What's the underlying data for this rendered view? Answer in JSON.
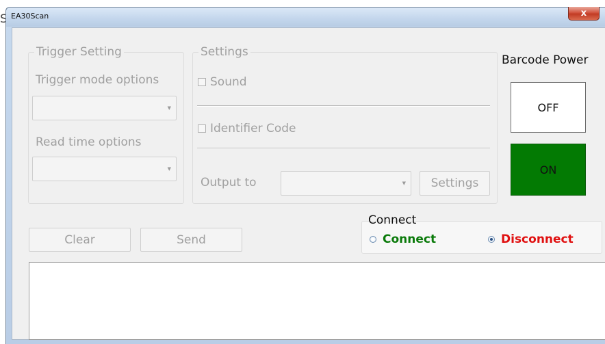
{
  "background_window": {
    "partial_char": "S"
  },
  "window": {
    "title": "EA30Scan",
    "close_glyph": "x"
  },
  "trigger_group": {
    "legend": "Trigger Setting",
    "mode_label": "Trigger mode options",
    "mode_value": "",
    "read_time_label": "Read time options",
    "read_time_value": ""
  },
  "settings_group": {
    "legend": "Settings",
    "sound_label": "Sound",
    "sound_checked": false,
    "identifier_label": "Identifier Code",
    "identifier_checked": false,
    "output_label": "Output to",
    "output_value": "",
    "settings_button": "Settings"
  },
  "barcode_power": {
    "title": "Barcode Power",
    "off_label": "OFF",
    "on_label": "ON",
    "on_color": "#037a03"
  },
  "actions": {
    "clear_label": "Clear",
    "send_label": "Send"
  },
  "connect_group": {
    "legend": "Connect",
    "connect_label": "Connect",
    "connect_color": "#0a7a0a",
    "connect_selected": false,
    "disconnect_label": "Disconnect",
    "disconnect_color": "#e01010",
    "disconnect_selected": true
  },
  "output_text": ""
}
